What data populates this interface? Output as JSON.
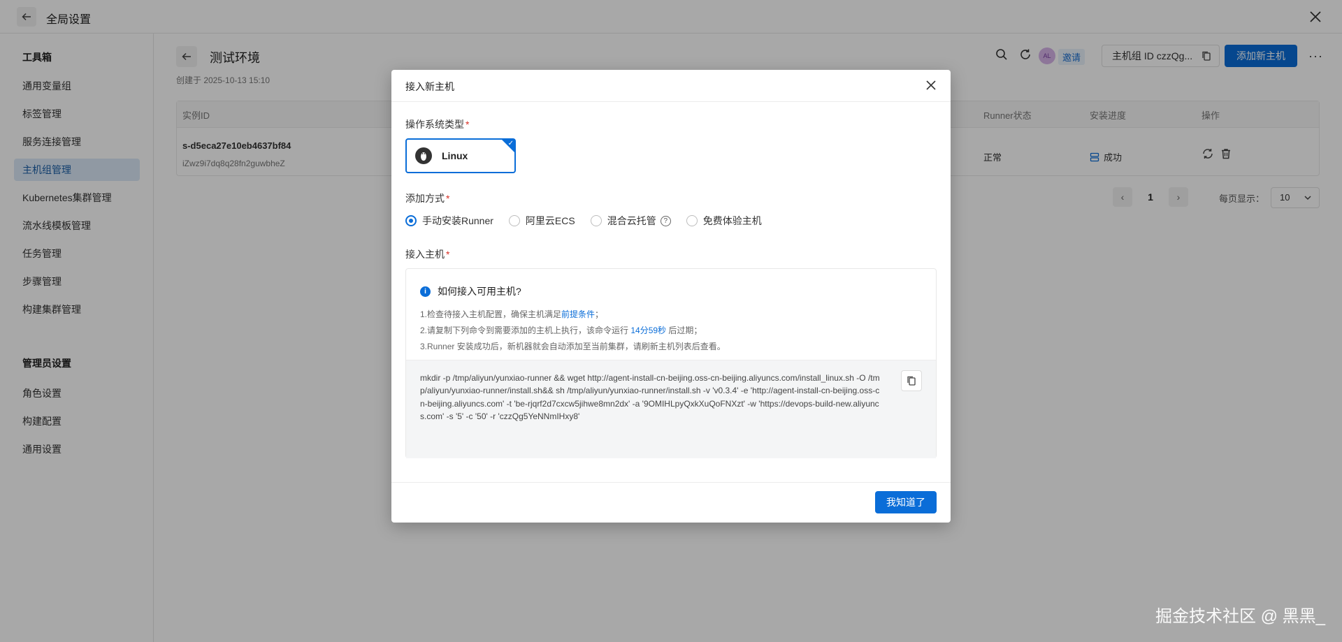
{
  "topbar": {
    "title": "全局设置"
  },
  "sidebar": {
    "group1_title": "工具箱",
    "items1": [
      "通用变量组",
      "标签管理",
      "服务连接管理",
      "主机组管理",
      "Kubernetes集群管理",
      "流水线模板管理",
      "任务管理",
      "步骤管理",
      "构建集群管理"
    ],
    "active_item": "主机组管理",
    "group2_title": "管理员设置",
    "items2": [
      "角色设置",
      "构建配置",
      "通用设置"
    ]
  },
  "page": {
    "title": "测试环境",
    "created": "创建于 2025-10-13 15:10",
    "avatar_initials": "AL",
    "invite_label": "邀请",
    "group_id": "主机组 ID czzQg...",
    "add_host_label": "添加新主机",
    "more_label": "···"
  },
  "table": {
    "columns": [
      "实例ID",
      "Runner状态",
      "安装进度",
      "操作"
    ],
    "rows": [
      {
        "instance_id": "s-d5eca27e10eb4637bf84",
        "instance_sub": "iZwz9i7dq8q28fn2guwbheZ",
        "runner_status": "正常",
        "progress": "成功"
      }
    ]
  },
  "pager": {
    "current": "1",
    "per_page_label": "每页显示：",
    "per_page": "10"
  },
  "watermark": "掘金技术社区 @ 黑黑_",
  "modal": {
    "title": "接入新主机",
    "os_label": "操作系统类型",
    "os_selected": "Linux",
    "method_label": "添加方式",
    "methods": [
      "手动安装Runner",
      "阿里云ECS",
      "混合云托管",
      "免费体验主机"
    ],
    "selected_method": "手动安装Runner",
    "host_label": "接入主机",
    "info_title": "如何接入可用主机?",
    "step1_prefix": "1.检查待接入主机配置，确保主机满足",
    "step1_link": "前提条件",
    "step1_suffix": "；",
    "step2_prefix": "2.请复制下列命令到需要添加的主机上执行，该命令运行",
    "step2_time": "14分59秒",
    "step2_suffix": "后过期；",
    "step3": "3.Runner 安装成功后，新机器就会自动添加至当前集群，请刷新主机列表后查看。",
    "command": "mkdir -p /tmp/aliyun/yunxiao-runner && wget http://agent-install-cn-beijing.oss-cn-beijing.aliyuncs.com/install_linux.sh -O /tmp/aliyun/yunxiao-runner/install.sh&& sh /tmp/aliyun/yunxiao-runner/install.sh -v 'v0.3.4' -e 'http://agent-install-cn-beijing.oss-cn-beijing.aliyuncs.com' -t 'be-rjqrf2d7cxcw5jihwe8mn2dx' -a '9OMIHLpyQxkXuQoFNXzt' -w 'https://devops-build-new.aliyuncs.com' -s '5' -c '50' -r 'czzQg5YeNNmIHxy8'",
    "ok_label": "我知道了"
  }
}
